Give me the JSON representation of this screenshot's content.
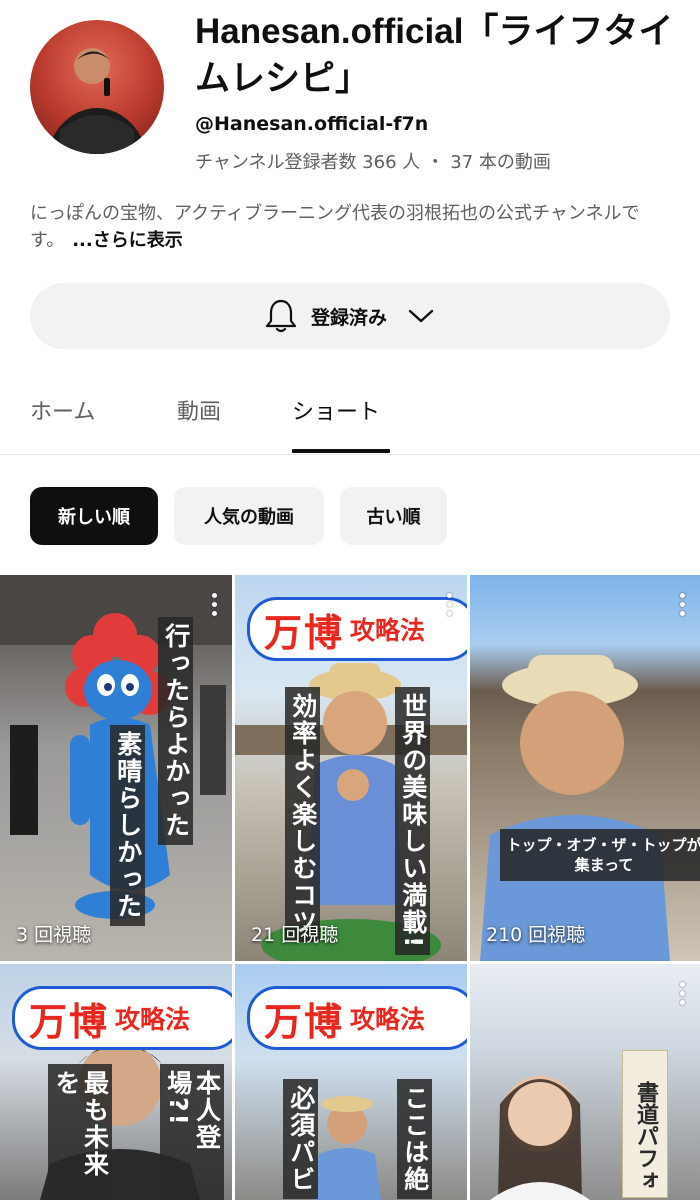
{
  "channel": {
    "name": "Hanesan.official「ライフタイムレシピ」",
    "handle": "@Hanesan.official-f7n",
    "subscribers": "チャンネル登録者数 366 人",
    "separator": "・",
    "video_count": "37 本の動画",
    "description": "にっぽんの宝物、アクティブラーニング代表の羽根拓也の公式チャンネルです。",
    "more_label": "...さらに表示"
  },
  "subscribe": {
    "label": "登録済み",
    "bell_icon": "bell-icon",
    "chevron_icon": "chevron-down-icon"
  },
  "tabs": [
    {
      "label": "ホーム",
      "active": false
    },
    {
      "label": "動画",
      "active": false
    },
    {
      "label": "ショート",
      "active": true
    }
  ],
  "filters": [
    {
      "label": "新しい順",
      "active": true
    },
    {
      "label": "人気の動画",
      "active": false
    },
    {
      "label": "古い順",
      "active": false
    }
  ],
  "shorts": [
    {
      "views": "3 回視聴",
      "captions": [
        "行ったらよかった",
        "素晴らしかった"
      ]
    },
    {
      "views": "21 回視聴",
      "logo_big": "万博",
      "logo_small": "攻略法",
      "captions": [
        "世界の美味しい満載!",
        "効率よく楽しむコツ"
      ]
    },
    {
      "views": "210 回視聴",
      "caption": "トップ・オブ・ザ・トップが\n集まって"
    },
    {
      "logo_big": "万博",
      "logo_small": "攻略法",
      "captions": [
        "本人登場?!",
        "最も未来を"
      ]
    },
    {
      "logo_big": "万博",
      "logo_small": "攻略法",
      "captions": [
        "ここは絶",
        "必須パビ"
      ]
    },
    {
      "sign": "書道パフォ"
    }
  ]
}
